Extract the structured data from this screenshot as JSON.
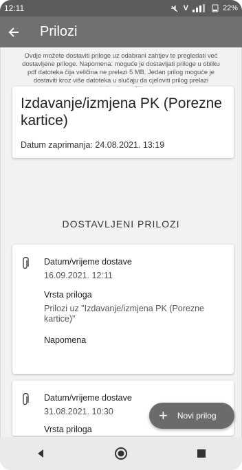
{
  "status": {
    "time": "12:11",
    "indicators": " ",
    "battery": "22%"
  },
  "appbar": {
    "title": "Prilozi"
  },
  "info_text": "Ovdje možete dostaviti priloge uz odabrani zahtjev te pregledati već dostavljene priloge. Napomena: moguće je dostavljati priloge u obliku pdf datoteka čija veličina ne prelazi 5 MB. Jedan prilog moguće je dostaviti kroz više datoteka u slučaju da cjeloviti prilog prelazi maksimalnu veličinu.",
  "request": {
    "title": "Izdavanje/izmjena PK (Porezne kartice)",
    "date_text": "Datum zaprimanja: 24.08.2021. 13:19"
  },
  "section_title": "DOSTAVLJENI PRILOZI",
  "attachments": [
    {
      "date_label": "Datum/vrijeme dostave",
      "date_value": "16.09.2021. 12:11",
      "type_label": "Vrsta priloga",
      "type_value": "Prilozi uz \"Izdavanje/izmjena PK (Porezne kartice)\"",
      "note_label": "Napomena"
    },
    {
      "date_label": "Datum/vrijeme dostave",
      "date_value": "31.08.2021. 10:30",
      "type_label": "Vrsta priloga"
    }
  ],
  "fab": {
    "label": "Novi prilog"
  },
  "icons": [
    "back-arrow-icon",
    "paperclip-icon",
    "plus-icon",
    "nav-back-icon",
    "nav-home-icon",
    "nav-recents-icon"
  ]
}
